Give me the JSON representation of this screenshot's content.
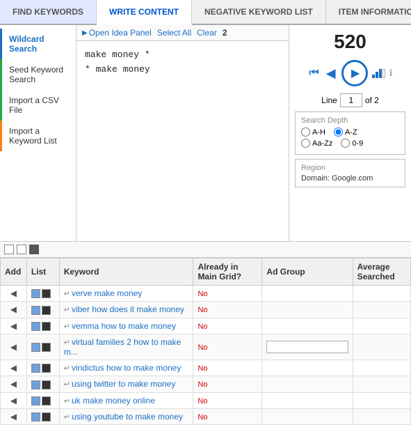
{
  "tabs": [
    {
      "id": "find-keywords",
      "label": "FIND KEYWORDS",
      "active": false
    },
    {
      "id": "write-content",
      "label": "WRITE CONTENT",
      "active": true
    },
    {
      "id": "negative-keyword",
      "label": "NEGATIVE KEYWORD LIST",
      "active": false
    },
    {
      "id": "item-information",
      "label": "ITEM INFORMATION",
      "active": false
    }
  ],
  "sidebar": {
    "items": [
      {
        "id": "wildcard-search",
        "label": "Wildcard Search",
        "state": "active-blue"
      },
      {
        "id": "seed-keyword",
        "label": "Seed Keyword Search",
        "state": "active-green"
      },
      {
        "id": "import-csv",
        "label": "Import a CSV File",
        "state": "active-green"
      },
      {
        "id": "import-keyword",
        "label": "Import a Keyword List",
        "state": "active-orange"
      }
    ]
  },
  "toolbar": {
    "open_idea_label": "Open Idea Panel",
    "select_all_label": "Select All",
    "clear_label": "Clear",
    "count": "2"
  },
  "text_content": "make money *\n* make money",
  "player": {
    "count": "520",
    "line_value": "1",
    "line_of": "of 2",
    "line_label": "Line"
  },
  "search_depth": {
    "title": "Search Depth",
    "options": [
      "A-H",
      "A-Z",
      "Aa-Zz",
      "0-9"
    ],
    "selected": "A-Z"
  },
  "region": {
    "title": "Region",
    "domain": "Domain: Google.com"
  },
  "table": {
    "headers": [
      "Add",
      "List",
      "Keyword",
      "Already in Main Grid?",
      "Ad Group",
      "Average Searched"
    ],
    "rows": [
      {
        "keyword": "verve make money",
        "already": "No",
        "adgroup": "",
        "has_input": false
      },
      {
        "keyword": "viber how does it make money",
        "already": "No",
        "adgroup": "",
        "has_input": false
      },
      {
        "keyword": "vemma how to make money",
        "already": "No",
        "adgroup": "",
        "has_input": false
      },
      {
        "keyword": "virtual families 2 how to make m...",
        "already": "No",
        "adgroup": "",
        "has_input": true
      },
      {
        "keyword": "vindictus how to make money",
        "already": "No",
        "adgroup": "",
        "has_input": false
      },
      {
        "keyword": "using twitter to make money",
        "already": "No",
        "adgroup": "",
        "has_input": false
      },
      {
        "keyword": "uk make money online",
        "already": "No",
        "adgroup": "",
        "has_input": false
      },
      {
        "keyword": "using youtube to make money",
        "already": "No",
        "adgroup": "",
        "has_input": false
      }
    ]
  }
}
